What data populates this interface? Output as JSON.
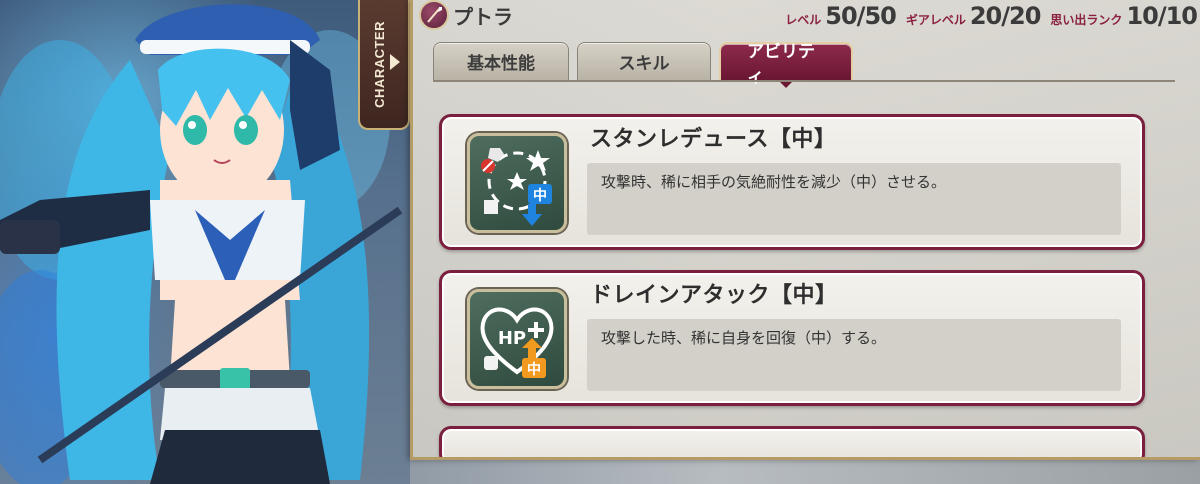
{
  "character_tab": {
    "label": "CHARACTER",
    "arrow_icon": "triangle-right-icon"
  },
  "header": {
    "weapon_icon": "spear-icon",
    "name": "プトラ",
    "stats": [
      {
        "label": "レベル",
        "value": "50/50"
      },
      {
        "label": "ギアレベル",
        "value": "20/20"
      },
      {
        "label": "思い出ランク",
        "value": "10/10"
      }
    ]
  },
  "tabs": [
    {
      "label": "基本性能",
      "active": false
    },
    {
      "label": "スキル",
      "active": false
    },
    {
      "label": "アビリティ",
      "active": true
    }
  ],
  "abilities": [
    {
      "icon": "stun-reduce-icon",
      "title": "スタンレデュース【中】",
      "description": "攻撃時、稀に相手の気絶耐性を減少（中）させる。",
      "badge": "中"
    },
    {
      "icon": "hp-drain-icon",
      "title": "ドレインアタック【中】",
      "description": "攻撃した時、稀に自身を回復（中）する。",
      "badge": "中",
      "heart_text": "HP"
    }
  ],
  "colors": {
    "accent": "#7b1f3f",
    "active_tab": "#8e2a4c",
    "gold_border": "#c9b27a"
  }
}
